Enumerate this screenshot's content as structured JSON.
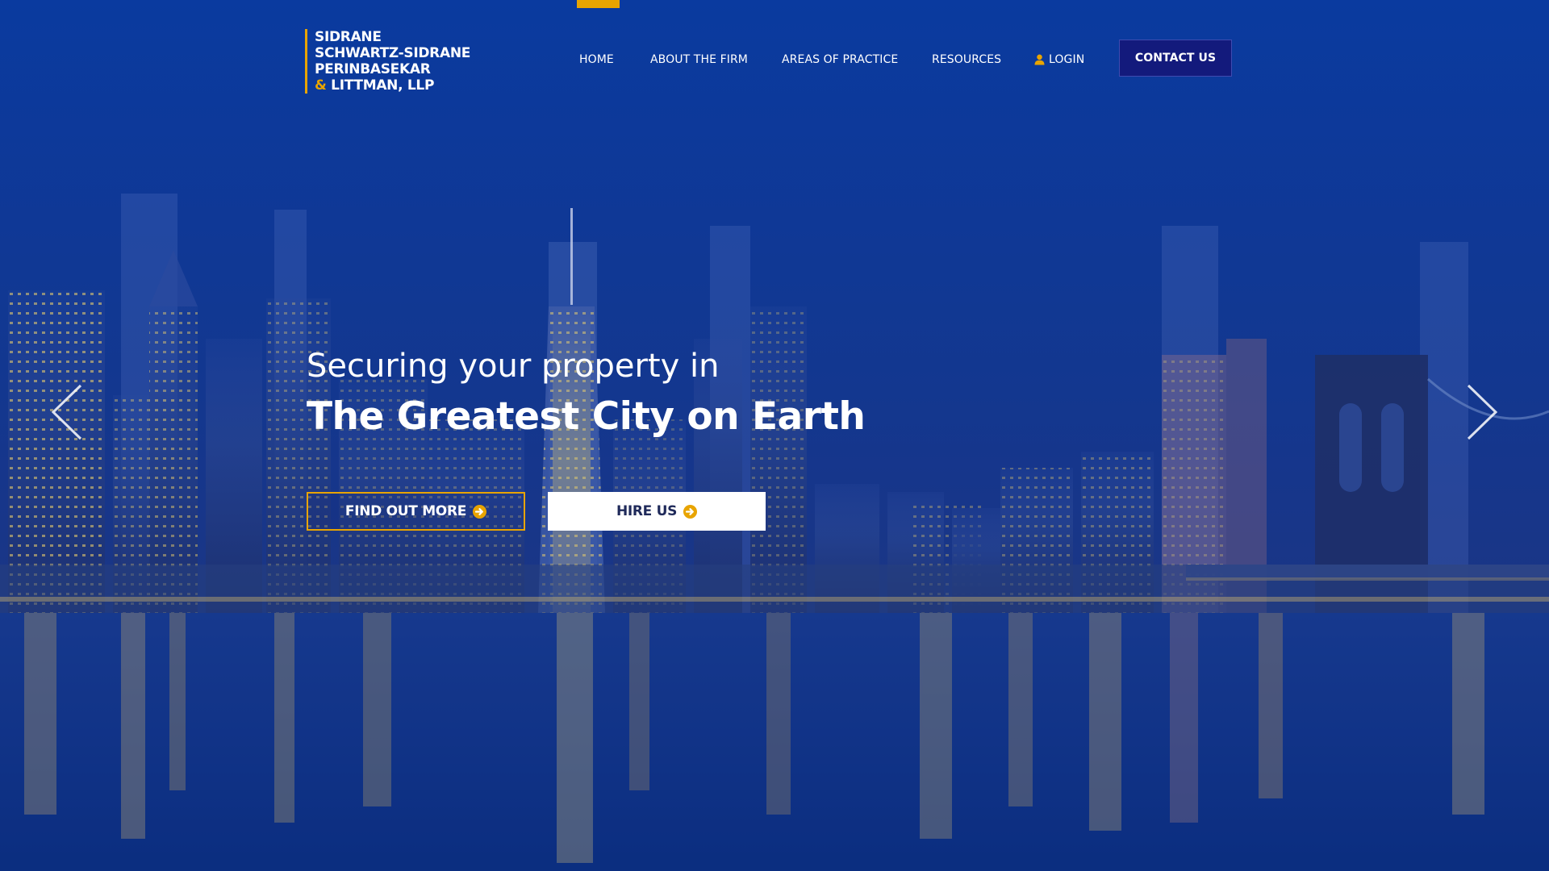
{
  "logo": {
    "lines": [
      "SIDRANE",
      "SCHWARTZ-SIDRANE",
      "PERINBASEKAR"
    ],
    "last_line_amp": "&",
    "last_line_text": "LITTMAN, LLP"
  },
  "nav": {
    "items": [
      {
        "label": "HOME",
        "active": true
      },
      {
        "label": "ABOUT THE FIRM"
      },
      {
        "label": "AREAS OF PRACTICE"
      },
      {
        "label": "RESOURCES"
      },
      {
        "label": "LOGIN",
        "icon": "user-icon"
      }
    ],
    "contact_label": "CONTACT US"
  },
  "hero": {
    "subtitle": "Securing your property in",
    "title": "The Greatest City on Earth",
    "buttons": [
      {
        "label": "FIND OUT MORE",
        "icon": "arrow-circle-right-icon"
      },
      {
        "label": "HIRE US",
        "icon": "arrow-circle-right-icon"
      }
    ],
    "prev_icon": "chevron-left-icon",
    "next_icon": "chevron-right-icon"
  },
  "colors": {
    "accent": "#e8a400",
    "contact_bg": "#131a7c",
    "overlay_blue": "#0a3a9e"
  }
}
